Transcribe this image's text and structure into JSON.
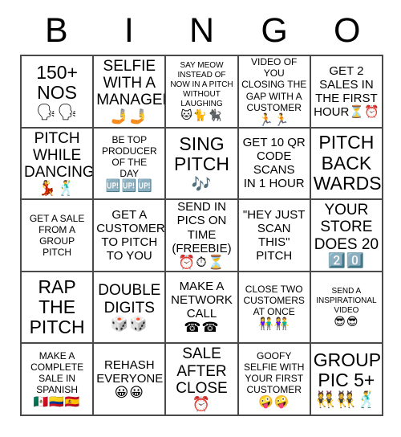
{
  "header": {
    "letters": [
      "B",
      "I",
      "N",
      "G",
      "O"
    ]
  },
  "grid": {
    "rows": 5,
    "cols": 5,
    "border_color": "#4a4a4a",
    "background": "#ffffff",
    "cells": [
      {
        "text": "150+\nNOS",
        "emoji": "🗣🗣",
        "size": "xl"
      },
      {
        "text": "SELFIE\nWITH A\nMANAGER",
        "emoji": "🤳🤳",
        "size": "lg"
      },
      {
        "text": "SAY MEOW\nINSTEAD OF\nNOW IN A PITCH\nWITHOUT\nLAUGHING",
        "emoji": "🐱🐈🐈‍⬛",
        "size": "xs"
      },
      {
        "text": "VIDEO OF YOU\nCLOSING THE\nGAP WITH A\nCUSTOMER",
        "emoji": "🏃🏃",
        "size": "sm"
      },
      {
        "text": "GET 2\nSALES IN\nTHE FIRST\nHOUR⏳⏰",
        "emoji": "",
        "size": "md"
      },
      {
        "text": "PITCH\nWHILE\nDANCING",
        "emoji": "💃🕺",
        "size": "lg"
      },
      {
        "text": "BE TOP\nPRODUCER\nOF THE\nDAY",
        "emoji": "🆙🆙🆙",
        "size": "sm"
      },
      {
        "text": "SING\nPITCH",
        "emoji": "🎶",
        "size": "xl"
      },
      {
        "text": "GET 10 QR\nCODE\nSCANS\nIN 1 HOUR",
        "emoji": "",
        "size": "md"
      },
      {
        "text": "PITCH\nBACK\nWARDS",
        "emoji": "",
        "size": "xl"
      },
      {
        "text": "GET A SALE\nFROM A\nGROUP\nPITCH",
        "emoji": "",
        "size": "sm"
      },
      {
        "text": "GET A\nCUSTOMER\nTO PITCH\nTO YOU",
        "emoji": "",
        "size": "md"
      },
      {
        "text": "SEND IN\nPICS ON\nTIME\n(FREEBIE)",
        "emoji": "⏰⏱⏳",
        "size": "md"
      },
      {
        "text": "\"HEY JUST\nSCAN THIS\"\nPITCH",
        "emoji": "",
        "size": "md"
      },
      {
        "text": "YOUR\nSTORE\nDOES 20",
        "emoji": "2️⃣0️⃣",
        "size": "lg"
      },
      {
        "text": "RAP\nTHE\nPITCH",
        "emoji": "",
        "size": "xl"
      },
      {
        "text": "DOUBLE\nDIGITS",
        "emoji": "🎲🎲",
        "size": "lg"
      },
      {
        "text": "MAKE A\nNETWORK\nCALL",
        "emoji": "☎☎",
        "size": "md"
      },
      {
        "text": "CLOSE TWO\nCUSTOMERS\nAT ONCE",
        "emoji": "👫👫",
        "size": "sm"
      },
      {
        "text": "SEND A\nINSPIRATIONAL\nVIDEO",
        "emoji": "😎😎",
        "size": "xs"
      },
      {
        "text": "MAKE A\nCOMPLETE\nSALE IN\nSPANISH",
        "emoji": "🇲🇽🇨🇴🇪🇸",
        "size": "sm"
      },
      {
        "text": "REHASH\nEVERYONE",
        "emoji": "😀😀",
        "size": "md"
      },
      {
        "text": "SALE\nAFTER\nCLOSE",
        "emoji": "⏰",
        "size": "lg"
      },
      {
        "text": "GOOFY\nSELFIE WITH\nYOUR FIRST\nCUSTOMER",
        "emoji": "🤪🤪",
        "size": "sm"
      },
      {
        "text": "GROUP\nPIC 5+",
        "emoji": "👯👯🕺",
        "size": "xl"
      }
    ]
  }
}
